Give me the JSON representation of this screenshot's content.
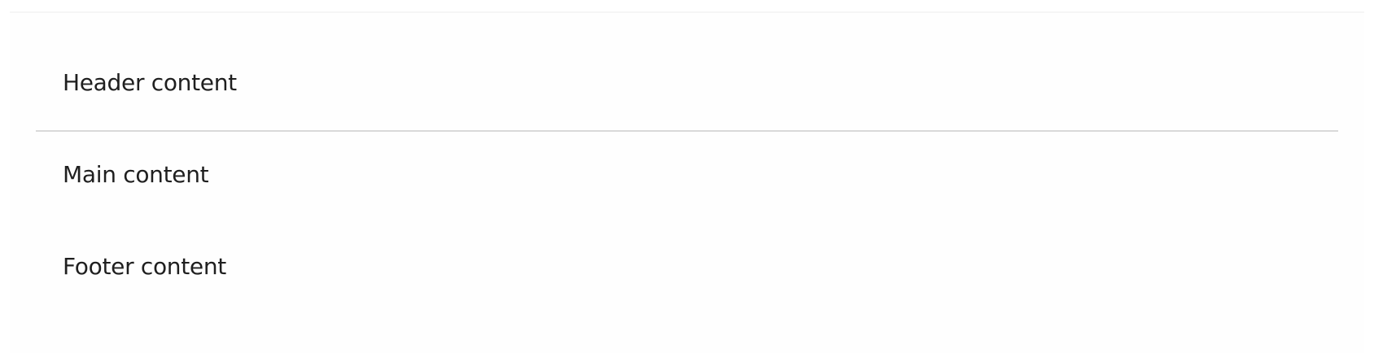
{
  "header": {
    "text": "Header content"
  },
  "main": {
    "text": "Main content"
  },
  "footer": {
    "text": "Footer content"
  }
}
